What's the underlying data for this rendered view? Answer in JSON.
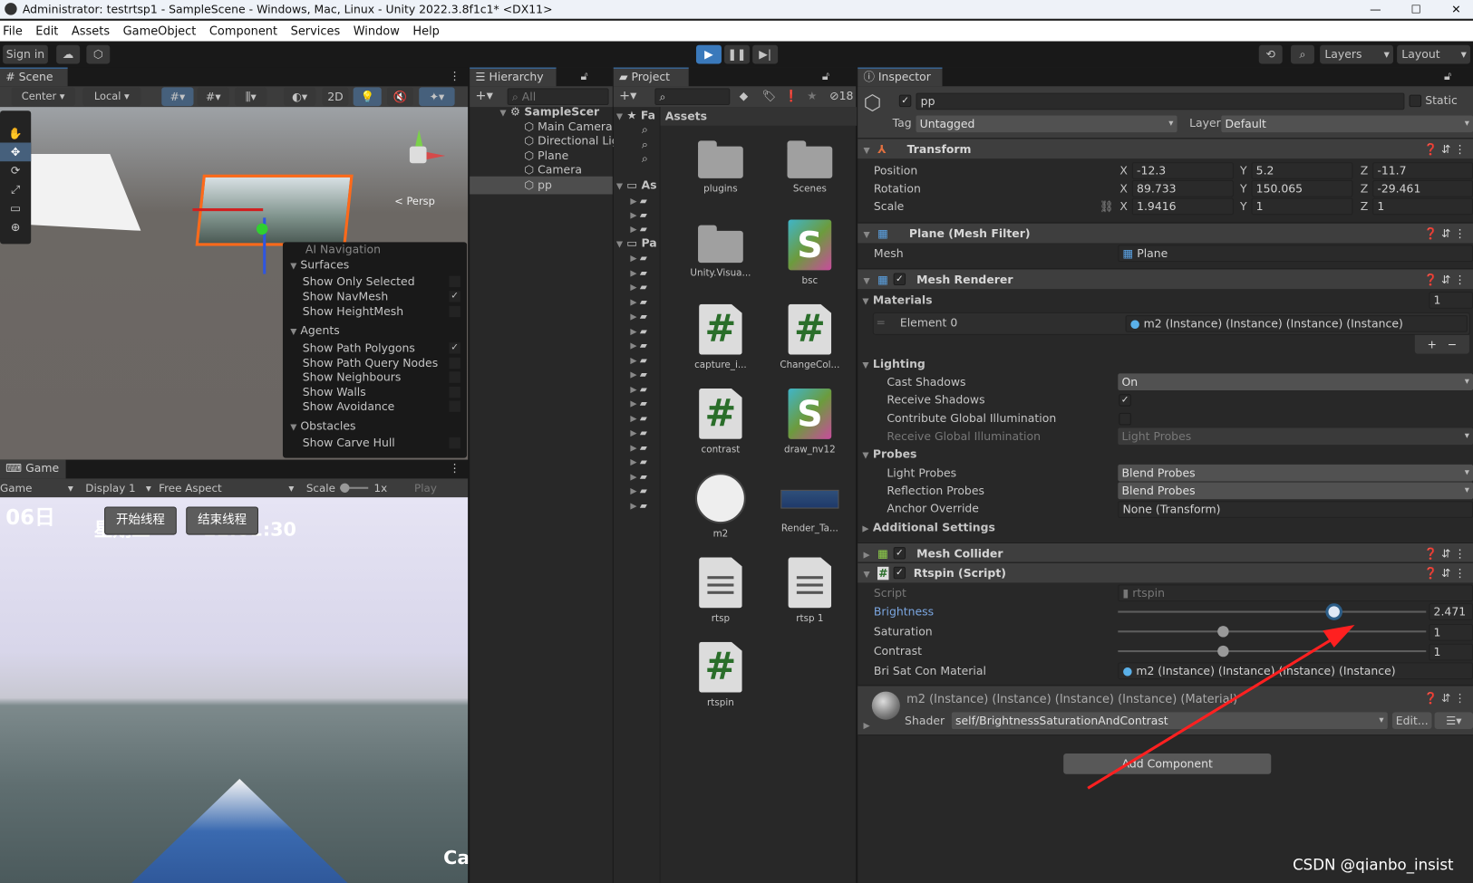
{
  "window": {
    "title": "Administrator: testrtsp1 - SampleScene - Windows, Mac, Linux - Unity 2022.3.8f1c1* <DX11>"
  },
  "menu": [
    "File",
    "Edit",
    "Assets",
    "GameObject",
    "Component",
    "Services",
    "Window",
    "Help"
  ],
  "toolbar": {
    "sign_in": "Sign in",
    "layers": "Layers",
    "layout": "Layout"
  },
  "scene": {
    "tab": "Scene",
    "pivot": "Center",
    "space": "Local",
    "mode2d": "2D",
    "persp": "< Persp",
    "ai_nav": {
      "title": "AI Navigation",
      "sections": [
        {
          "title": "Surfaces",
          "items": [
            {
              "label": "Show Only Selected",
              "checked": false
            },
            {
              "label": "Show NavMesh",
              "checked": true
            },
            {
              "label": "Show HeightMesh",
              "checked": false
            }
          ]
        },
        {
          "title": "Agents",
          "items": [
            {
              "label": "Show Path Polygons",
              "checked": true
            },
            {
              "label": "Show Path Query Nodes",
              "checked": false
            },
            {
              "label": "Show Neighbours",
              "checked": false
            },
            {
              "label": "Show Walls",
              "checked": false
            },
            {
              "label": "Show Avoidance",
              "checked": false
            }
          ]
        },
        {
          "title": "Obstacles",
          "items": [
            {
              "label": "Show Carve Hull",
              "checked": false
            }
          ]
        }
      ]
    }
  },
  "game": {
    "tab": "Game",
    "view": "Game",
    "display": "Display 1",
    "aspect": "Free Aspect",
    "scale_label": "Scale",
    "scale_value": "1x",
    "play_focus": "Play Focus",
    "overlay_date": "06日",
    "overlay_day": "星期三",
    "overlay_time": "11:01:30",
    "start_button": "开始线程",
    "stop_button": "结束线程",
    "corner_text": "Ca"
  },
  "hierarchy": {
    "tab": "Hierarchy",
    "search_placeholder": "All",
    "scene": "SampleScer",
    "items": [
      "Main Camera",
      "Directional Lig",
      "Plane",
      "Camera",
      "pp"
    ],
    "selected": "pp"
  },
  "project": {
    "tab": "Project",
    "hidden_count": "18",
    "favorites": "Fa",
    "assets_tree": "As",
    "packages_tree": "Pa",
    "breadcrumb": "Assets",
    "assets": [
      {
        "name": "plugins",
        "type": "folder"
      },
      {
        "name": "Scenes",
        "type": "folder"
      },
      {
        "name": "Unity.Visua...",
        "type": "folder"
      },
      {
        "name": "bsc",
        "type": "shader"
      },
      {
        "name": "capture_i...",
        "type": "script"
      },
      {
        "name": "ChangeCol...",
        "type": "script"
      },
      {
        "name": "contrast",
        "type": "script"
      },
      {
        "name": "draw_nv12",
        "type": "shader"
      },
      {
        "name": "m2",
        "type": "material"
      },
      {
        "name": "Render_Ta...",
        "type": "render-texture"
      },
      {
        "name": "rtsp",
        "type": "text"
      },
      {
        "name": "rtsp 1",
        "type": "text"
      },
      {
        "name": "rtspin",
        "type": "script"
      }
    ]
  },
  "inspector": {
    "tab": "Inspector",
    "name": "pp",
    "active": true,
    "static_label": "Static",
    "tag_label": "Tag",
    "tag": "Untagged",
    "layer_label": "Layer",
    "layer": "Default",
    "transform": {
      "title": "Transform",
      "rows": [
        {
          "label": "Position",
          "x": "-12.3",
          "y": "5.2",
          "z": "-11.7"
        },
        {
          "label": "Rotation",
          "x": "89.733",
          "y": "150.065",
          "z": "-29.461"
        },
        {
          "label": "Scale",
          "x": "1.9416",
          "y": "1",
          "z": "1"
        }
      ]
    },
    "mesh_filter": {
      "title": "Plane (Mesh Filter)",
      "mesh_label": "Mesh",
      "mesh": "Plane"
    },
    "mesh_renderer": {
      "title": "Mesh Renderer",
      "materials_label": "Materials",
      "materials_count": "1",
      "element_label": "Element 0",
      "element_value": "m2 (Instance) (Instance) (Instance) (Instance)",
      "lighting_label": "Lighting",
      "cast_shadows_label": "Cast Shadows",
      "cast_shadows": "On",
      "receive_shadows_label": "Receive Shadows",
      "receive_shadows": true,
      "contribute_gi_label": "Contribute Global Illumination",
      "contribute_gi": false,
      "receive_gi_label": "Receive Global Illumination",
      "receive_gi": "Light Probes",
      "probes_label": "Probes",
      "light_probes_label": "Light Probes",
      "light_probes": "Blend Probes",
      "reflection_probes_label": "Reflection Probes",
      "reflection_probes": "Blend Probes",
      "anchor_label": "Anchor Override",
      "anchor": "None (Transform)",
      "additional_label": "Additional Settings"
    },
    "mesh_collider": {
      "title": "Mesh Collider"
    },
    "script": {
      "title": "Rtspin (Script)",
      "script_label": "Script",
      "script": "rtspin",
      "brightness_label": "Brightness",
      "brightness": "2.471",
      "brightness_fraction": 0.7,
      "saturation_label": "Saturation",
      "saturation": "1",
      "saturation_fraction": 0.34,
      "contrast_label": "Contrast",
      "contrast": "1",
      "contrast_fraction": 0.34,
      "material_label": "Bri Sat Con Material",
      "material": "m2 (Instance) (Instance) (Instance) (Instance)"
    },
    "material": {
      "title": "m2 (Instance) (Instance) (Instance) (Instance) (Material)",
      "shader_label": "Shader",
      "shader": "self/BrightnessSaturationAndContrast",
      "edit": "Edit..."
    },
    "add_component": "Add Component"
  },
  "watermark": "CSDN @qianbo_insist",
  "colors": {
    "accent": "#3a79bb",
    "selection": "#2c5d87",
    "annotation_arrow": "#ff2020"
  }
}
